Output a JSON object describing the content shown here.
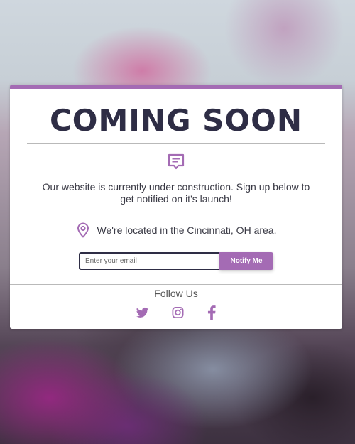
{
  "page": {
    "title": "COMING SOON",
    "description": "Our website is currently under construction. Sign up below to get notified on it's launch!",
    "location_text": "We're located in the Cincinnati, OH area."
  },
  "signup": {
    "email_placeholder": "Enter your email",
    "email_value": "",
    "button_label": "Notify Me"
  },
  "footer": {
    "follow_label": "Follow Us",
    "social_icons": [
      "twitter-icon",
      "instagram-icon",
      "facebook-icon"
    ]
  },
  "colors": {
    "accent": "#a46bb4",
    "title_text": "#2e2d45",
    "body_text": "#3a3a45"
  }
}
